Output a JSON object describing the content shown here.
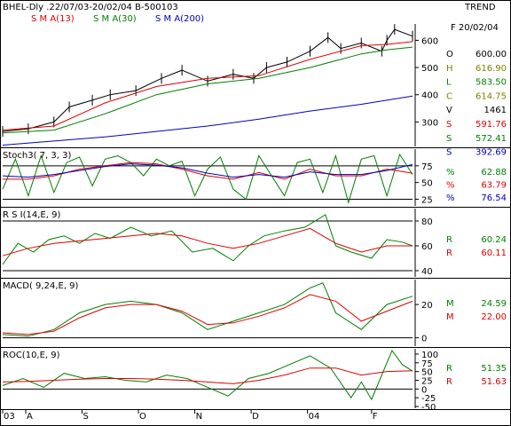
{
  "header": {
    "symbol_info": "BHEL-Dly .22/07/03-20/02/04  B-500103",
    "trend_label": "TREND",
    "date_label": "F 20/02/04",
    "sma13_label": "S M A(13)",
    "sma30_label": "S M A(30)",
    "sma200_label": "S M A(200)"
  },
  "colors": {
    "price": "#000000",
    "sma13": "#e00000",
    "sma30": "#008000",
    "sma200": "#0000c0",
    "stoch_k": "#008000",
    "stoch_d": "#e00000",
    "stoch_sd": "#0000c0",
    "grid": "#000000"
  },
  "readouts": {
    "ohlcv": [
      {
        "label": "O",
        "value": "600.00",
        "color": "#000000"
      },
      {
        "label": "H",
        "value": "616.90",
        "color": "#808000"
      },
      {
        "label": "L",
        "value": "583.50",
        "color": "#008000"
      },
      {
        "label": "C",
        "value": "614.75",
        "color": "#808000"
      },
      {
        "label": "V",
        "value": "1461",
        "color": "#000000"
      },
      {
        "label": "S",
        "value": "591.76",
        "color": "#e00000"
      },
      {
        "label": "S",
        "value": "572.41",
        "color": "#008000"
      },
      {
        "label": "S",
        "value": "392.69",
        "color": "#0000c0"
      }
    ],
    "stoch": [
      {
        "label": "%",
        "value": "62.88",
        "color": "#008000"
      },
      {
        "label": "%",
        "value": "63.79",
        "color": "#e00000"
      },
      {
        "label": "%",
        "value": "76.54",
        "color": "#0000c0"
      }
    ],
    "rsi": [
      {
        "label": "R",
        "value": "60.24",
        "color": "#008000"
      },
      {
        "label": "R",
        "value": "60.11",
        "color": "#e00000"
      }
    ],
    "macd": [
      {
        "label": "M",
        "value": "24.59",
        "color": "#008000"
      },
      {
        "label": "M",
        "value": "22.00",
        "color": "#e00000"
      }
    ],
    "roc": [
      {
        "label": "R",
        "value": "51.35",
        "color": "#008000"
      },
      {
        "label": "R",
        "value": "51.63",
        "color": "#e00000"
      }
    ]
  },
  "chart_data": [
    {
      "type": "line",
      "panel": "price",
      "ylim": [
        210,
        660
      ],
      "yticks": [
        300,
        400,
        500,
        600
      ],
      "series": [
        {
          "name": "Price (OHLC bars)",
          "x": [
            0,
            10,
            20,
            26,
            35,
            42,
            52,
            62,
            70,
            80,
            90,
            98,
            103,
            111,
            120,
            127,
            132,
            140,
            148,
            150,
            153,
            160
          ],
          "values": [
            265,
            275,
            300,
            355,
            380,
            400,
            415,
            460,
            490,
            450,
            475,
            460,
            500,
            520,
            560,
            610,
            570,
            590,
            560,
            600,
            640,
            615
          ]
        },
        {
          "name": "S M A(13)",
          "x": [
            0,
            20,
            40,
            60,
            80,
            100,
            120,
            140,
            150,
            160
          ],
          "values": [
            270,
            285,
            370,
            430,
            460,
            470,
            530,
            580,
            585,
            595
          ]
        },
        {
          "name": "S M A(30)",
          "x": [
            0,
            20,
            40,
            60,
            80,
            100,
            120,
            140,
            150,
            160
          ],
          "values": [
            260,
            270,
            330,
            400,
            440,
            460,
            500,
            550,
            565,
            575
          ]
        },
        {
          "name": "S M A(200)",
          "x": [
            0,
            20,
            40,
            60,
            80,
            100,
            120,
            140,
            160
          ],
          "values": [
            215,
            230,
            245,
            265,
            285,
            310,
            340,
            365,
            395
          ]
        }
      ]
    },
    {
      "type": "line",
      "panel": "stoch",
      "title": "Stoch3( 7, 3, 3)",
      "ylim": [
        15,
        100
      ],
      "yticks": [
        25,
        50,
        75
      ],
      "series": [
        {
          "name": "%K",
          "x": [
            0,
            5,
            10,
            15,
            20,
            25,
            30,
            35,
            40,
            45,
            50,
            55,
            60,
            65,
            70,
            75,
            80,
            85,
            90,
            95,
            100,
            105,
            110,
            115,
            120,
            125,
            130,
            135,
            140,
            145,
            150,
            155,
            160
          ],
          "values": [
            40,
            85,
            30,
            90,
            35,
            80,
            88,
            45,
            85,
            90,
            80,
            60,
            85,
            75,
            82,
            30,
            70,
            88,
            40,
            25,
            90,
            60,
            30,
            80,
            85,
            35,
            90,
            20,
            85,
            90,
            30,
            92,
            62
          ]
        },
        {
          "name": "%D",
          "x": [
            0,
            10,
            20,
            30,
            40,
            50,
            60,
            70,
            80,
            90,
            100,
            110,
            120,
            130,
            140,
            150,
            160
          ],
          "values": [
            55,
            55,
            60,
            70,
            75,
            80,
            78,
            70,
            60,
            55,
            65,
            55,
            70,
            60,
            60,
            70,
            64
          ]
        },
        {
          "name": "%S",
          "x": [
            0,
            10,
            20,
            30,
            40,
            50,
            60,
            70,
            80,
            90,
            100,
            110,
            120,
            130,
            140,
            150,
            160
          ],
          "values": [
            60,
            58,
            62,
            68,
            74,
            78,
            76,
            72,
            64,
            58,
            62,
            58,
            66,
            62,
            62,
            68,
            77
          ]
        }
      ]
    },
    {
      "type": "line",
      "panel": "rsi",
      "title": "R S I(14,E, 9)",
      "ylim": [
        35,
        90
      ],
      "yticks": [
        40,
        60,
        80
      ],
      "series": [
        {
          "name": "RSI",
          "x": [
            0,
            6,
            12,
            18,
            24,
            30,
            36,
            42,
            50,
            58,
            66,
            74,
            82,
            90,
            96,
            102,
            110,
            118,
            126,
            130,
            136,
            144,
            150,
            156,
            160
          ],
          "values": [
            45,
            62,
            55,
            65,
            68,
            62,
            70,
            66,
            75,
            68,
            72,
            55,
            58,
            48,
            60,
            68,
            72,
            75,
            85,
            60,
            55,
            50,
            65,
            63,
            60
          ]
        },
        {
          "name": "Signal",
          "x": [
            0,
            10,
            20,
            30,
            40,
            50,
            60,
            70,
            80,
            90,
            100,
            110,
            120,
            130,
            140,
            150,
            160
          ],
          "values": [
            52,
            58,
            62,
            64,
            66,
            68,
            70,
            68,
            62,
            58,
            62,
            68,
            74,
            62,
            55,
            60,
            60
          ]
        }
      ]
    },
    {
      "type": "line",
      "panel": "macd",
      "title": "MACD( 9,24,E, 9)",
      "ylim": [
        -5,
        35
      ],
      "yticks": [
        0,
        20
      ],
      "series": [
        {
          "name": "MACD",
          "x": [
            0,
            10,
            20,
            30,
            40,
            50,
            60,
            70,
            80,
            90,
            100,
            110,
            120,
            125,
            130,
            140,
            150,
            160
          ],
          "values": [
            2,
            1,
            5,
            15,
            20,
            22,
            20,
            15,
            5,
            10,
            15,
            20,
            30,
            33,
            15,
            5,
            20,
            25
          ]
        },
        {
          "name": "Signal",
          "x": [
            0,
            10,
            20,
            30,
            40,
            50,
            60,
            70,
            80,
            90,
            100,
            110,
            120,
            130,
            140,
            150,
            160
          ],
          "values": [
            3,
            2,
            4,
            12,
            18,
            20,
            20,
            16,
            8,
            9,
            13,
            18,
            26,
            22,
            10,
            16,
            22
          ]
        }
      ]
    },
    {
      "type": "line",
      "panel": "roc",
      "title": "ROC(10,E, 9)",
      "ylim": [
        -55,
        115
      ],
      "yticks": [
        -50,
        -25,
        0,
        25,
        50,
        75,
        100
      ],
      "series": [
        {
          "name": "ROC",
          "x": [
            0,
            8,
            16,
            24,
            32,
            40,
            48,
            56,
            64,
            72,
            80,
            88,
            96,
            104,
            112,
            120,
            128,
            136,
            140,
            144,
            152,
            156,
            160
          ],
          "values": [
            10,
            30,
            5,
            45,
            30,
            35,
            25,
            20,
            40,
            30,
            5,
            -20,
            30,
            45,
            70,
            95,
            60,
            -25,
            20,
            -30,
            110,
            70,
            51
          ]
        },
        {
          "name": "Signal",
          "x": [
            0,
            10,
            20,
            30,
            40,
            50,
            60,
            70,
            80,
            90,
            100,
            110,
            120,
            130,
            140,
            150,
            160
          ],
          "values": [
            20,
            22,
            25,
            28,
            30,
            30,
            28,
            25,
            20,
            15,
            25,
            40,
            60,
            60,
            40,
            50,
            52
          ]
        }
      ]
    }
  ],
  "x_axis": {
    "labels": [
      {
        "text": "03",
        "x": 0
      },
      {
        "text": "A",
        "x": 9
      },
      {
        "text": "S",
        "x": 31
      },
      {
        "text": "O",
        "x": 53
      },
      {
        "text": "N",
        "x": 75
      },
      {
        "text": "D",
        "x": 97
      },
      {
        "text": "04",
        "x": 119
      },
      {
        "text": "F",
        "x": 144
      }
    ],
    "xlim": [
      0,
      160
    ]
  }
}
